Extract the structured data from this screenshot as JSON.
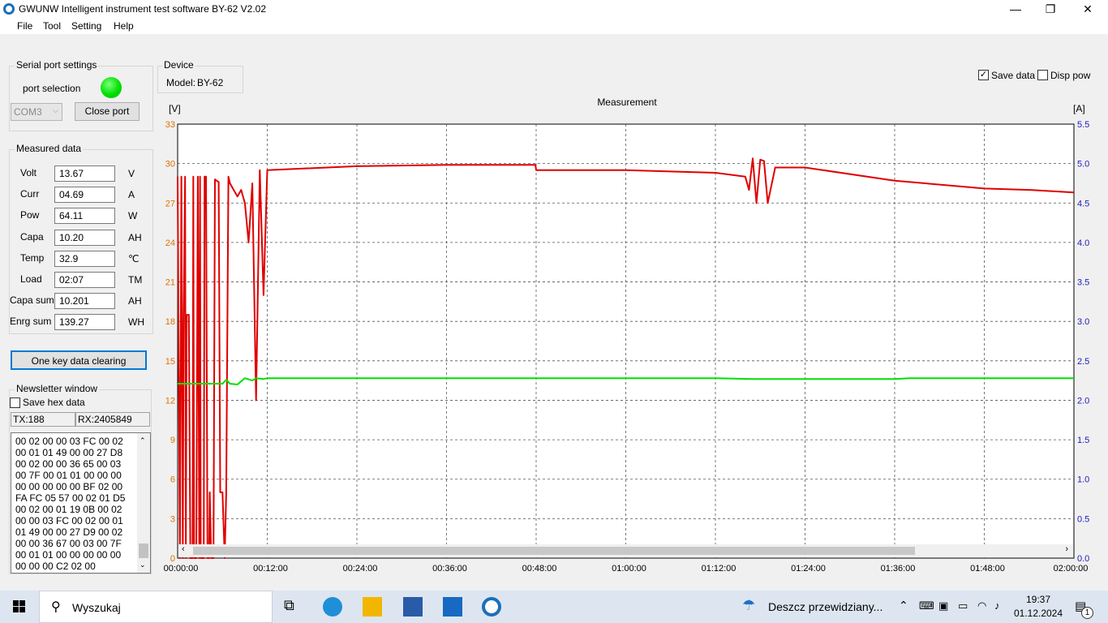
{
  "window": {
    "title": "GWUNW Intelligent instrument test software BY-62 V2.02",
    "minimize": "—",
    "maximize": "❐",
    "close": "✕"
  },
  "menu": [
    "File",
    "Tool",
    "Setting",
    "Help"
  ],
  "serial": {
    "group_title": "Serial port settings",
    "port_selection": "port selection",
    "port_value": "COM3",
    "close_port": "Close port",
    "status_color": "#00e000"
  },
  "device": {
    "group_title": "Device",
    "model_label": "Model:",
    "model_value": "BY-62"
  },
  "measured": {
    "group_title": "Measured data",
    "rows": [
      {
        "label": "Volt",
        "value": "13.67",
        "unit": "V"
      },
      {
        "label": "Curr",
        "value": "04.69",
        "unit": "A"
      },
      {
        "label": "Pow",
        "value": "64.11",
        "unit": "W"
      },
      {
        "label": "Capa",
        "value": "10.20",
        "unit": "AH"
      },
      {
        "label": "Temp",
        "value": "32.9",
        "unit": "℃"
      },
      {
        "label": "Load",
        "value": "02:07",
        "unit": "TM"
      },
      {
        "label": "Capa sum",
        "value": "10.201",
        "unit": "AH"
      },
      {
        "label": "Enrg sum",
        "value": "139.27",
        "unit": "WH"
      }
    ]
  },
  "clear_button": "One key data clearing",
  "newsletter": {
    "group_title": "Newsletter window",
    "save_hex": "Save hex data",
    "tx": "TX:188",
    "rx": "RX:2405849",
    "lines": [
      "00 02 00 00 03 FC 00 02",
      "00 01 01 49 00 00 27 D8",
      "00 02 00 00 36 65 00 03",
      "00 7F 00 01 01 00 00 00",
      "00 00 00 00 00 BF 02 00",
      "FA FC 05 57 00 02 01 D5",
      "00 02 00 01 19 0B 00 02",
      "00 00 03 FC 00 02 00 01",
      "01 49 00 00 27 D9 00 02",
      "00 00 36 67 00 03 00 7F",
      "00 01 01 00 00 00 00 00",
      "00 00 00 C2 02 00"
    ]
  },
  "options": {
    "save_data": "Save data",
    "save_data_checked": true,
    "disp_pow": "Disp pow",
    "disp_pow_checked": false
  },
  "chart_data": {
    "type": "line",
    "title": "Measurement",
    "ylabel_left": "[V]",
    "ylabel_right": "[A]",
    "ylim_left": [
      0,
      33
    ],
    "ylim_right": [
      0,
      5.5
    ],
    "yticks_left": [
      "33",
      "30",
      "27",
      "24",
      "21",
      "18",
      "15",
      "12",
      "9",
      "6",
      "3",
      "0"
    ],
    "yticks_right": [
      "5.5",
      "5.0",
      "4.5",
      "4.0",
      "3.5",
      "3.0",
      "2.5",
      "2.0",
      "1.5",
      "1.0",
      "0.5",
      "0.0"
    ],
    "xticks": [
      "00:00:00",
      "00:12:00",
      "00:24:00",
      "00:36:00",
      "00:48:00",
      "01:00:00",
      "01:12:00",
      "01:24:00",
      "01:36:00",
      "01:48:00",
      "02:00:00"
    ],
    "grid": true,
    "left_tick_color": "#e07000",
    "right_tick_color": "#2020c0",
    "series": [
      {
        "color": "#e00000",
        "axis": "left",
        "x": [
          0.0,
          0.3,
          0.5,
          0.7,
          0.8,
          1.0,
          1.1,
          1.2,
          1.5,
          1.7,
          2.0,
          2.1,
          2.2,
          2.5,
          2.7,
          2.9,
          3.0,
          3.1,
          3.3,
          3.5,
          3.6,
          3.8,
          4.0,
          4.2,
          4.3,
          4.5,
          4.8,
          5.0,
          5.2,
          5.5,
          5.7,
          6.0,
          6.3,
          6.5,
          6.8,
          7.0,
          7.5,
          8.0,
          8.5,
          9.0,
          9.5,
          10.0,
          10.5,
          11.0,
          11.5,
          12.0,
          24.0,
          36.0,
          47.9,
          48.0,
          60.0,
          72.0,
          76.0,
          76.5,
          77.0,
          77.5,
          78.0,
          78.5,
          79.0,
          80.0,
          84.0,
          96.0,
          108.0,
          114.0,
          120.0
        ],
        "y": [
          29.0,
          0.0,
          29.0,
          0.0,
          18.5,
          29.0,
          0.0,
          18.5,
          18.5,
          0.0,
          0.0,
          29.0,
          0.0,
          0.0,
          29.0,
          0.0,
          29.0,
          0.0,
          0.0,
          0.0,
          29.0,
          29.0,
          0.0,
          0.0,
          5.0,
          0.0,
          0.0,
          28.8,
          28.7,
          28.6,
          5.0,
          5.0,
          0.0,
          5.0,
          29.0,
          28.5,
          28.0,
          27.5,
          28.0,
          27.0,
          24.0,
          28.5,
          12.0,
          29.5,
          20.0,
          29.5,
          29.8,
          29.9,
          29.9,
          29.5,
          29.5,
          29.3,
          29.0,
          28.0,
          30.4,
          27.0,
          30.3,
          30.2,
          27.0,
          29.7,
          29.7,
          28.7,
          28.1,
          28.0,
          27.8
        ]
      },
      {
        "color": "#00e000",
        "axis": "right",
        "x": [
          0.0,
          6.0,
          6.5,
          7.0,
          8.0,
          9.0,
          10.0,
          10.5,
          11.5,
          12.0,
          24.0,
          36.0,
          48.0,
          60.0,
          72.0,
          77.0,
          84.0,
          96.0,
          98.0,
          108.0,
          120.0
        ],
        "y": [
          2.21,
          2.21,
          2.26,
          2.21,
          2.2,
          2.28,
          2.25,
          2.28,
          2.27,
          2.28,
          2.28,
          2.28,
          2.28,
          2.28,
          2.28,
          2.27,
          2.27,
          2.27,
          2.28,
          2.28,
          2.28
        ]
      }
    ]
  },
  "taskbar": {
    "search": "Wyszukaj",
    "weather": "Deszcz przewidziany...",
    "time": "19:37",
    "date": "01.12.2024",
    "notifications": "1"
  }
}
